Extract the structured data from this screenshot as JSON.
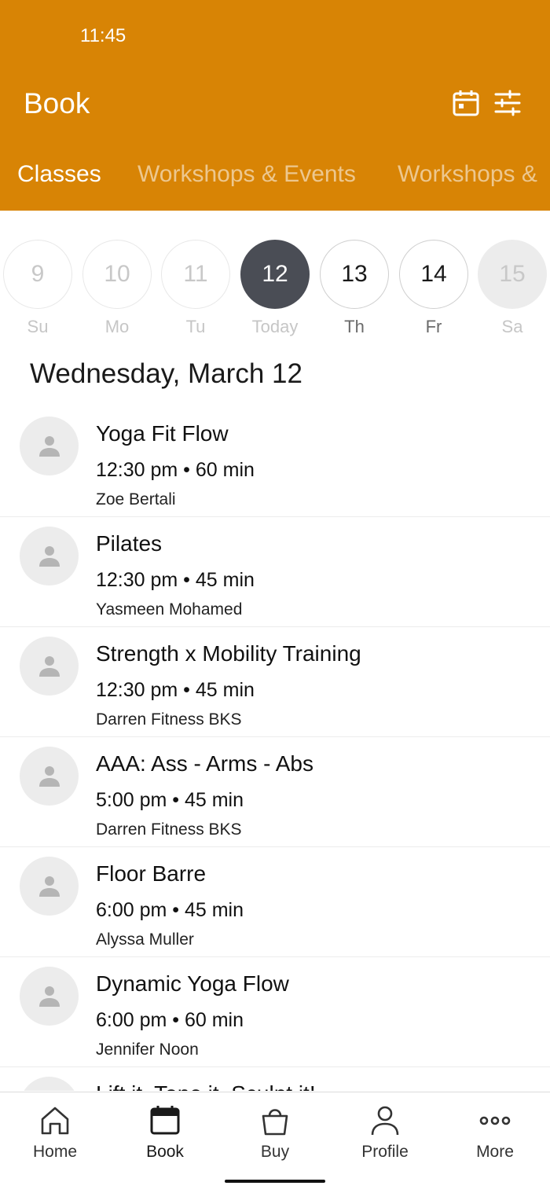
{
  "status_bar": {
    "time": "11:45"
  },
  "header": {
    "title": "Book",
    "background": "#D88405",
    "icons": [
      "calendar-icon",
      "filter-sliders-icon"
    ]
  },
  "tabs": [
    {
      "label": "Classes",
      "active": true
    },
    {
      "label": "Workshops & Events",
      "active": false
    },
    {
      "label": "Workshops &",
      "active": false
    }
  ],
  "days": [
    {
      "num": "9",
      "label": "Su",
      "state": "past"
    },
    {
      "num": "10",
      "label": "Mo",
      "state": "past"
    },
    {
      "num": "11",
      "label": "Tu",
      "state": "past"
    },
    {
      "num": "12",
      "label": "Today",
      "state": "selected"
    },
    {
      "num": "13",
      "label": "Th",
      "state": "future"
    },
    {
      "num": "14",
      "label": "Fr",
      "state": "future"
    },
    {
      "num": "15",
      "label": "Sa",
      "state": "disabled"
    }
  ],
  "date_heading": "Wednesday, March 12",
  "classes": [
    {
      "name": "Yoga Fit Flow",
      "time": "12:30 pm • 60 min",
      "instructor": "Zoe Bertali"
    },
    {
      "name": "Pilates",
      "time": "12:30 pm • 45 min",
      "instructor": "Yasmeen Mohamed"
    },
    {
      "name": "Strength x Mobility Training",
      "time": "12:30 pm • 45 min",
      "instructor": "Darren Fitness BKS"
    },
    {
      "name": "AAA: Ass - Arms - Abs",
      "time": "5:00 pm • 45 min",
      "instructor": "Darren Fitness BKS"
    },
    {
      "name": "Floor Barre",
      "time": "6:00 pm • 45 min",
      "instructor": "Alyssa Muller"
    },
    {
      "name": "Dynamic Yoga Flow",
      "time": "6:00 pm • 60 min",
      "instructor": "Jennifer Noon"
    },
    {
      "name": "Lift it, Tone it, Sculpt it!",
      "time": "",
      "instructor": ""
    }
  ],
  "bottom_nav": [
    {
      "label": "Home",
      "icon": "home-icon"
    },
    {
      "label": "Book",
      "icon": "calendar-book-icon",
      "active": true
    },
    {
      "label": "Buy",
      "icon": "shopping-bag-icon"
    },
    {
      "label": "Profile",
      "icon": "person-icon"
    },
    {
      "label": "More",
      "icon": "more-dots-icon"
    }
  ]
}
